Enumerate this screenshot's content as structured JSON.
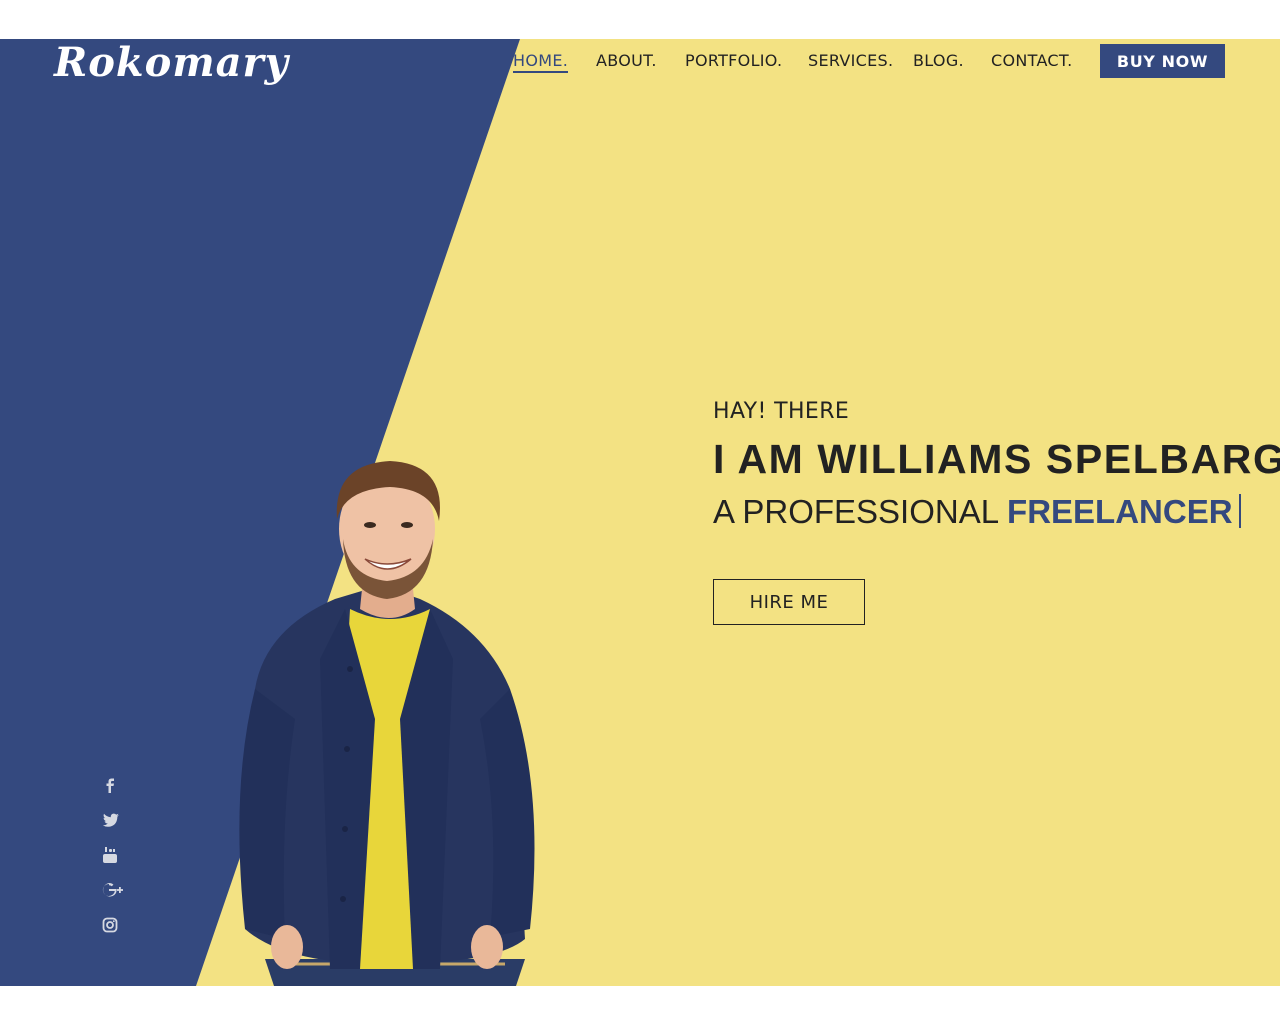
{
  "brand": {
    "logo_text": "Rokomary"
  },
  "nav": {
    "items": [
      {
        "label": "HOME.",
        "active": true
      },
      {
        "label": "ABOUT.",
        "active": false
      },
      {
        "label": "PORTFOLIO.",
        "active": false
      },
      {
        "label": "SERVICES.",
        "active": false
      },
      {
        "label": "BLOG.",
        "active": false
      },
      {
        "label": "CONTACT.",
        "active": false
      }
    ],
    "buy_label": "BUY NOW"
  },
  "hero": {
    "greeting": "HAY! THERE",
    "name": "I AM WILLIAMS SPELBARG,",
    "role_prefix": "A PROFESSIONAL",
    "role_highlight": "FREELANCER",
    "hire_label": "HIRE ME"
  },
  "social": [
    "facebook-icon",
    "twitter-icon",
    "youtube-icon",
    "google-plus-icon",
    "instagram-icon"
  ],
  "colors": {
    "navy": "#34497f",
    "yellow": "#f3e283",
    "text": "#222222",
    "shirt": "#e8d63a",
    "jacket": "#27355f"
  }
}
